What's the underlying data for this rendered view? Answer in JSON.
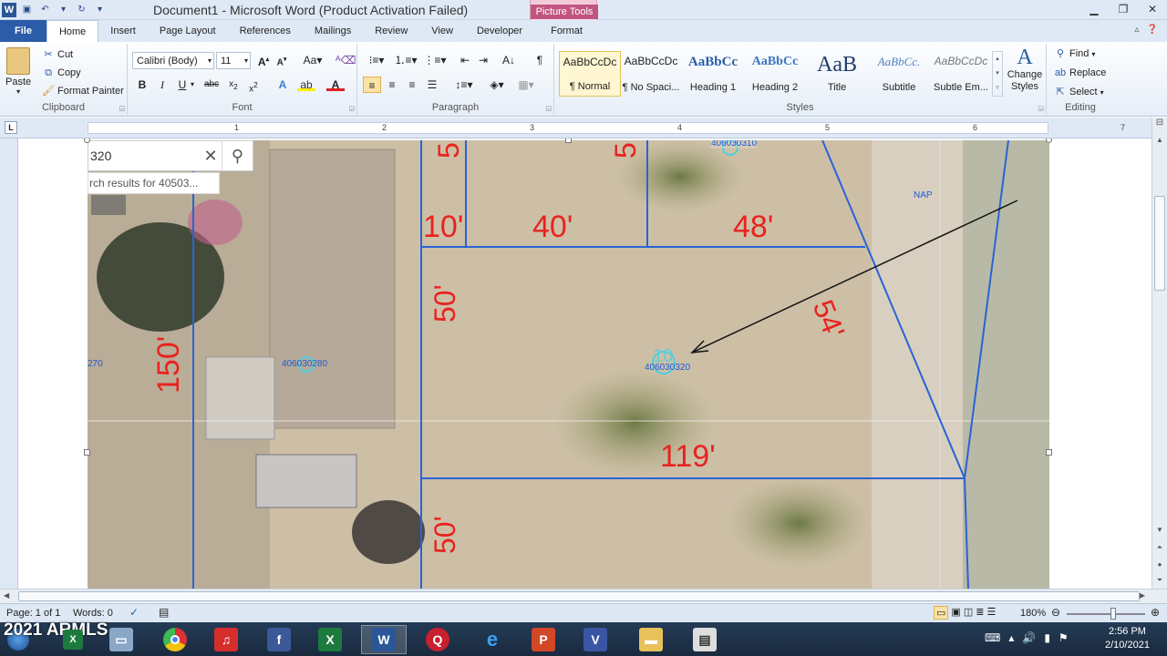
{
  "window": {
    "title": "Document1  -  Microsoft Word (Product Activation Failed)",
    "contextual_group": "Picture Tools",
    "controls": [
      "minimize",
      "restore",
      "close"
    ]
  },
  "tabs": [
    {
      "label": "File"
    },
    {
      "label": "Home"
    },
    {
      "label": "Insert"
    },
    {
      "label": "Page Layout"
    },
    {
      "label": "References"
    },
    {
      "label": "Mailings"
    },
    {
      "label": "Review"
    },
    {
      "label": "View"
    },
    {
      "label": "Developer"
    },
    {
      "label": "Format"
    }
  ],
  "ribbon": {
    "clipboard": {
      "label": "Clipboard",
      "paste": "Paste",
      "cut": "Cut",
      "copy": "Copy",
      "format_painter": "Format Painter"
    },
    "font": {
      "label": "Font",
      "font_name": "Calibri (Body)",
      "font_size": "11"
    },
    "paragraph": {
      "label": "Paragraph"
    },
    "styles": {
      "label": "Styles",
      "items": [
        {
          "preview": "AaBbCcDc",
          "name": "¶ Normal"
        },
        {
          "preview": "AaBbCcDc",
          "name": "¶ No Spaci..."
        },
        {
          "preview": "AaBbCc",
          "name": "Heading 1"
        },
        {
          "preview": "AaBbCc",
          "name": "Heading 2"
        },
        {
          "preview": "AaB",
          "name": "Title"
        },
        {
          "preview": "AaBbCc.",
          "name": "Subtitle"
        },
        {
          "preview": "AaBbCcDc",
          "name": "Subtle Em..."
        }
      ],
      "change_styles": "Change Styles"
    },
    "editing": {
      "label": "Editing",
      "find": "Find",
      "replace": "Replace",
      "select": "Select"
    }
  },
  "ruler": {
    "tab_selector": "L",
    "numbers": [
      "1",
      "2",
      "3",
      "4",
      "5",
      "6",
      "7"
    ]
  },
  "map": {
    "search_value": "320",
    "search_hint": "rch results for 40503...",
    "parcels": [
      "406030310",
      "406030280",
      "406030320"
    ],
    "left_parcel_fragment": "270",
    "nap_label": "NAP",
    "dimensions": [
      "10'",
      "40'",
      "48'",
      "50'",
      "54'",
      "150'",
      "119'",
      "50'"
    ],
    "partial_top_label": "5",
    "partial_top_label_2": "5",
    "lot_number": "10"
  },
  "status": {
    "page": "Page: 1 of 1",
    "words": "Words: 0",
    "zoom": "180%"
  },
  "taskbar": {
    "watermark": "2021 ARMLS",
    "time": "2:56 PM",
    "date": "2/10/2021"
  }
}
